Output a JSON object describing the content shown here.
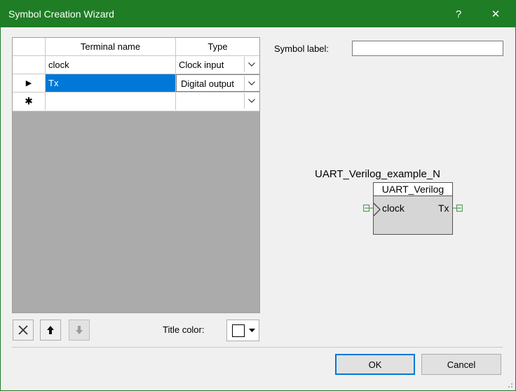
{
  "window": {
    "title": "Symbol Creation Wizard",
    "help_label": "?",
    "close_label": "✕",
    "titlebar_color": "#1f7d25"
  },
  "grid": {
    "headers": [
      "Terminal name",
      "Type"
    ],
    "rows": [
      {
        "indicator": "",
        "name": "clock",
        "type": "Clock input",
        "selected": false
      },
      {
        "indicator": "▶",
        "name": "Tx",
        "type": "Digital output",
        "selected": true
      },
      {
        "indicator": "✱",
        "name": "",
        "type": "",
        "selected": false
      }
    ],
    "selection_color": "#0078d7"
  },
  "toolbar": {
    "delete_icon": "delete-x-icon",
    "move_up_icon": "arrow-up-icon",
    "move_down_icon": "arrow-down-icon",
    "title_color_label": "Title color:",
    "title_color_value": "#ffffff"
  },
  "symbol": {
    "label_caption": "Symbol label:",
    "label_value": "",
    "instance_name": "UART_Verilog_example_N",
    "title": "UART_Verilog",
    "left_port": "clock",
    "right_port": "Tx"
  },
  "buttons": {
    "ok": "OK",
    "cancel": "Cancel"
  }
}
